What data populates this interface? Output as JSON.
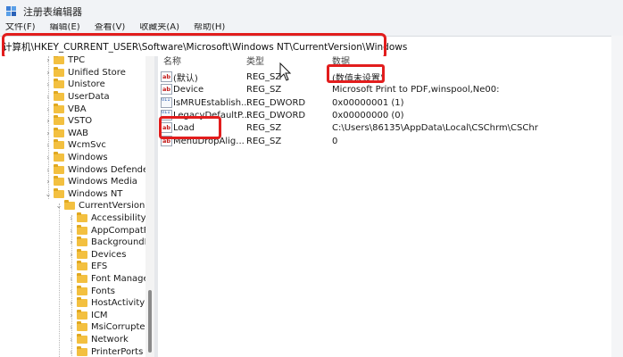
{
  "window": {
    "title": "注册表编辑器"
  },
  "menu": {
    "items": [
      "文件(F)",
      "编辑(E)",
      "查看(V)",
      "收藏夹(A)",
      "帮助(H)"
    ]
  },
  "address": {
    "path": "计算机\\HKEY_CURRENT_USER\\Software\\Microsoft\\Windows NT\\CurrentVersion\\Windows"
  },
  "tree": {
    "items": [
      {
        "label": "TPC",
        "level": 0
      },
      {
        "label": "Unified Store",
        "level": 0
      },
      {
        "label": "Unistore",
        "level": 0
      },
      {
        "label": "UserData",
        "level": 0
      },
      {
        "label": "VBA",
        "level": 0
      },
      {
        "label": "VSTO",
        "level": 0
      },
      {
        "label": "WAB",
        "level": 0
      },
      {
        "label": "WcmSvc",
        "level": 0
      },
      {
        "label": "Windows",
        "level": 0
      },
      {
        "label": "Windows Defender",
        "level": 0
      },
      {
        "label": "Windows Media",
        "level": 0
      },
      {
        "label": "Windows NT",
        "level": 0,
        "expanded": true
      },
      {
        "label": "CurrentVersion",
        "level": 1,
        "expanded": true
      },
      {
        "label": "Accessibility",
        "level": 2
      },
      {
        "label": "AppCompatFlags",
        "level": 2
      },
      {
        "label": "BackgroundModel",
        "level": 2
      },
      {
        "label": "Devices",
        "level": 2
      },
      {
        "label": "EFS",
        "level": 2
      },
      {
        "label": "Font Management",
        "level": 2
      },
      {
        "label": "Fonts",
        "level": 2
      },
      {
        "label": "HostActivityManager",
        "level": 2
      },
      {
        "label": "ICM",
        "level": 2
      },
      {
        "label": "MsiCorruptedFileRecovery",
        "level": 2
      },
      {
        "label": "Network",
        "level": 2
      },
      {
        "label": "PrinterPorts",
        "level": 2
      }
    ]
  },
  "list": {
    "headers": {
      "name": "名称",
      "type": "类型",
      "data": "数据"
    },
    "rows": [
      {
        "icon": "ab",
        "name": "(默认)",
        "type": "REG_SZ",
        "data": "(数值未设置)"
      },
      {
        "icon": "ab",
        "name": "Device",
        "type": "REG_SZ",
        "data": "Microsoft Print to PDF,winspool,Ne00:"
      },
      {
        "icon": "bin",
        "name": "IsMRUEstablish...",
        "type": "REG_DWORD",
        "data": "0x00000001 (1)"
      },
      {
        "icon": "bin",
        "name": "LegacyDefaultP...",
        "type": "REG_DWORD",
        "data": "0x00000000 (0)"
      },
      {
        "icon": "ab",
        "name": "Load",
        "type": "REG_SZ",
        "data": "C:\\Users\\86135\\AppData\\Local\\CSChrm\\CSChr"
      },
      {
        "icon": "ab",
        "name": "MenuDropAlig...",
        "type": "REG_SZ",
        "data": "0"
      }
    ]
  },
  "colors": {
    "highlight": "#e21d1d",
    "folder": "#f3c040",
    "background": "#eef0f3"
  }
}
